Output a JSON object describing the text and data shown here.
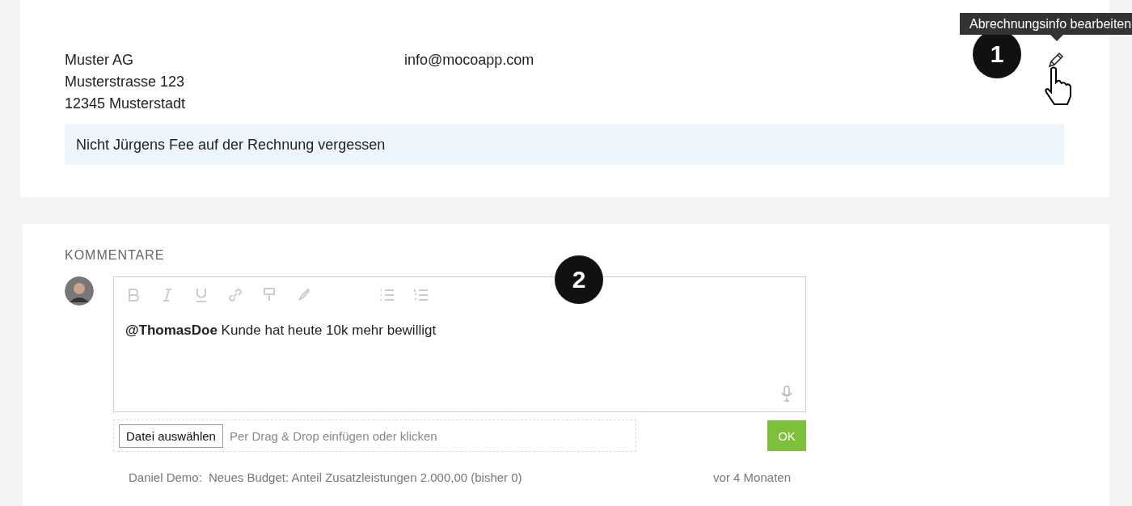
{
  "billing": {
    "address_lines": [
      "Muster AG",
      "Musterstrasse 123",
      "12345 Musterstadt"
    ],
    "email": "info@mocoapp.com",
    "note": "Nicht Jürgens Fee auf der Rechnung vergessen",
    "tooltip": "Abrechnungsinfo bearbeiten",
    "marker": "1"
  },
  "comments": {
    "heading": "KOMMENTARE",
    "marker": "2",
    "draft": "**@ThomasDoe** Kunde hat heute 10k mehr bewilligt",
    "file_button": "Datei auswählen",
    "drop_hint": "Per Drag & Drop einfügen oder klicken",
    "submit": "OK",
    "entries": [
      {
        "author": "Daniel Demo:",
        "text": "Neues Budget: Anteil Zusatzleistungen 2.000,00 (bisher 0)",
        "time": "vor 4 Monaten"
      }
    ]
  }
}
